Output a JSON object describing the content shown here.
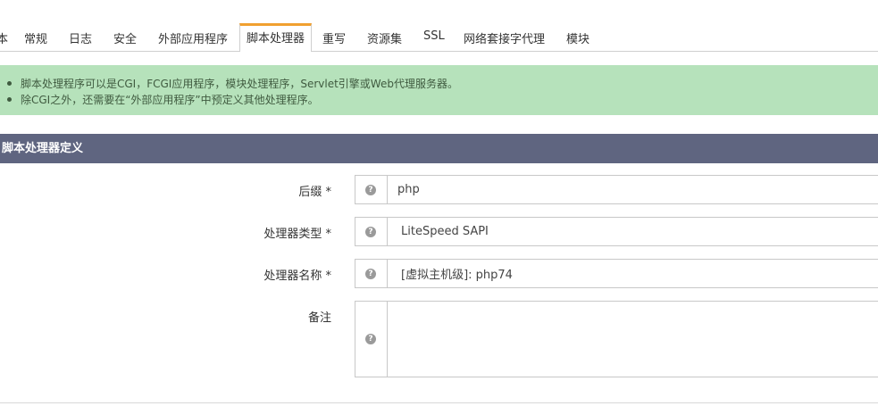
{
  "tabs": {
    "partial_label": "本",
    "items": [
      {
        "label": "常规"
      },
      {
        "label": "日志"
      },
      {
        "label": "安全"
      },
      {
        "label": "外部应用程序"
      },
      {
        "label": "脚本处理器"
      },
      {
        "label": "重写"
      },
      {
        "label": "资源集"
      },
      {
        "label": "SSL"
      },
      {
        "label": "网络套接字代理"
      },
      {
        "label": "模块"
      }
    ],
    "active_index": 4
  },
  "info": {
    "lines": [
      "脚本处理程序可以是CGI，FCGI应用程序，模块处理程序，Servlet引擎或Web代理服务器。",
      "除CGI之外，还需要在“外部应用程序”中预定义其他处理程序。"
    ]
  },
  "section": {
    "title": "脚本处理器定义"
  },
  "form": {
    "help_glyph": "?",
    "suffix": {
      "label": "后缀 *",
      "value": "php"
    },
    "handler_type": {
      "label": "处理器类型 *",
      "value": "LiteSpeed SAPI"
    },
    "handler_name": {
      "label": "处理器名称 *",
      "value": "[虚拟主机级]: php74"
    },
    "notes": {
      "label": "备注",
      "value": ""
    }
  },
  "colors": {
    "active_tab_accent": "#f0a030",
    "info_bg": "#b6e2bb",
    "section_header_bg": "#5f6580"
  },
  "icons": {
    "help": "question-circle-icon"
  }
}
